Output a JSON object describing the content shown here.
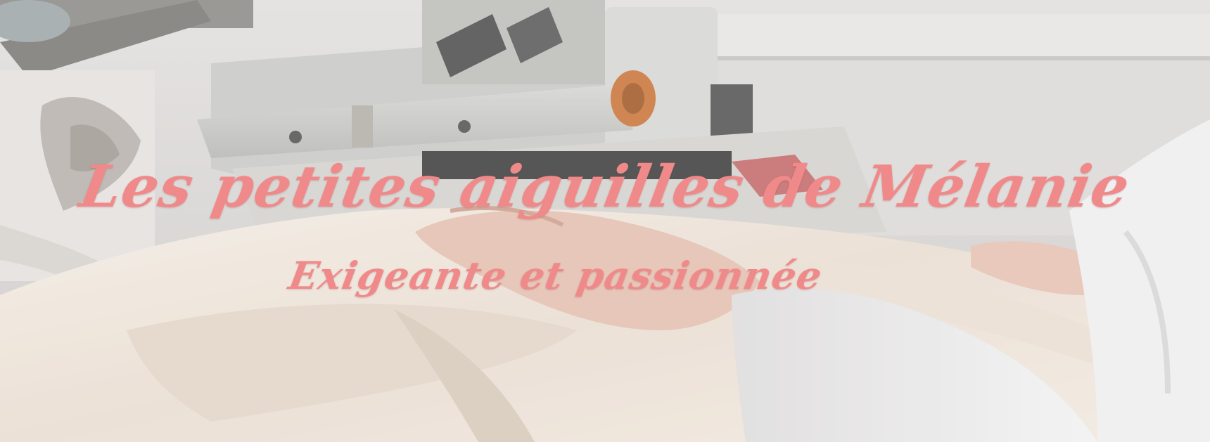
{
  "hero": {
    "title": "Les petites aiguilles de Mélanie",
    "subtitle": "Exigeante et passionnée"
  },
  "colors": {
    "title_text": "#f08a8a",
    "fabric": "#efe6dc",
    "machine": "#d9d9d6",
    "background_wall": "#dcd9d6",
    "skin": "#e8c3b4"
  }
}
